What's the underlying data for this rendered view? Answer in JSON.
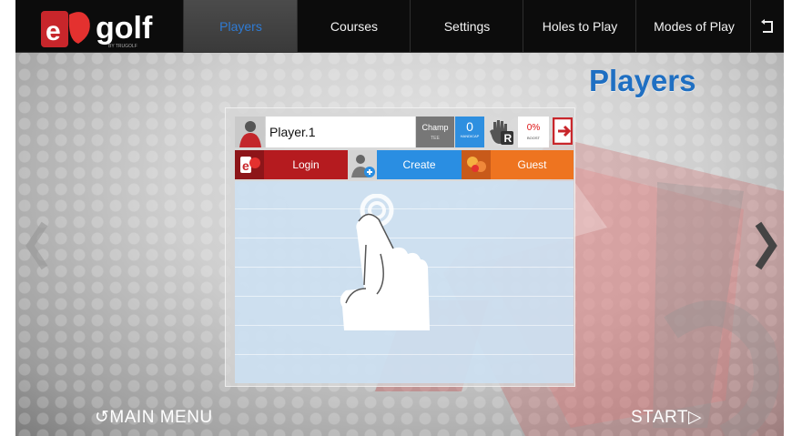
{
  "nav": {
    "items": [
      {
        "label": "Players",
        "active": true
      },
      {
        "label": "Courses",
        "active": false
      },
      {
        "label": "Settings",
        "active": false
      },
      {
        "label": "Holes to Play",
        "active": false
      },
      {
        "label": "Modes of Play",
        "active": false
      }
    ],
    "back_icon": "back-arrow-icon",
    "logo_text": "golf",
    "logo_subtext": "BY TRUGOLF"
  },
  "page": {
    "title": "Players"
  },
  "player": {
    "name": "Player.1",
    "champ_label": "Champ",
    "champ_sub": "TEE",
    "handicap_value": "0",
    "handicap_label": "HANDICAP",
    "hand_badge": "R",
    "boost_value": "0%",
    "boost_label": "BOOST"
  },
  "actions": {
    "login": "Login",
    "create": "Create",
    "guest": "Guest"
  },
  "footer": {
    "main_menu": "MAIN MENU",
    "main_menu_icon": "↺",
    "start": "START",
    "start_icon": "▷"
  },
  "colors": {
    "accent": "#1f6fc2",
    "login": "#b51b1f",
    "create": "#2a8ee2",
    "guest": "#ee7420",
    "topbar": "#0c0c0c"
  }
}
